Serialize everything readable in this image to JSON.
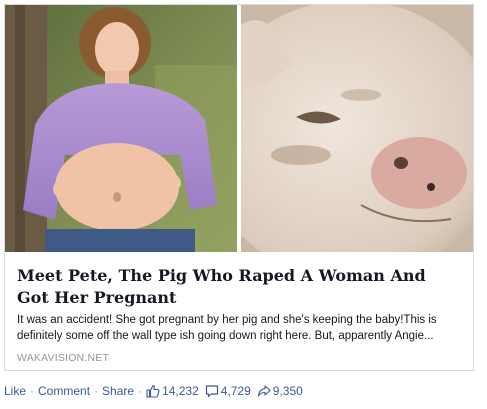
{
  "card": {
    "title": "Meet Pete, The Pig Who Raped A Woman And Got Her Pregnant",
    "description": "It was an accident! She got pregnant by her pig and she's keeping the baby!This is definitely some off the wall type ish going down right here. But, apparently Angie...",
    "domain": "WAKAVISION.NET"
  },
  "actions": {
    "like": "Like",
    "comment": "Comment",
    "share": "Share",
    "separator": "·"
  },
  "stats": {
    "likes": "14,232",
    "comments": "4,729",
    "shares": "9,350"
  },
  "icons": {
    "likes": "thumbs-up-icon",
    "comments": "speech-bubble-icon",
    "shares": "share-arrow-icon"
  },
  "colors": {
    "link": "#3b5998",
    "title": "#141823",
    "muted": "#9197a3",
    "card_border": "#d7d9de"
  }
}
